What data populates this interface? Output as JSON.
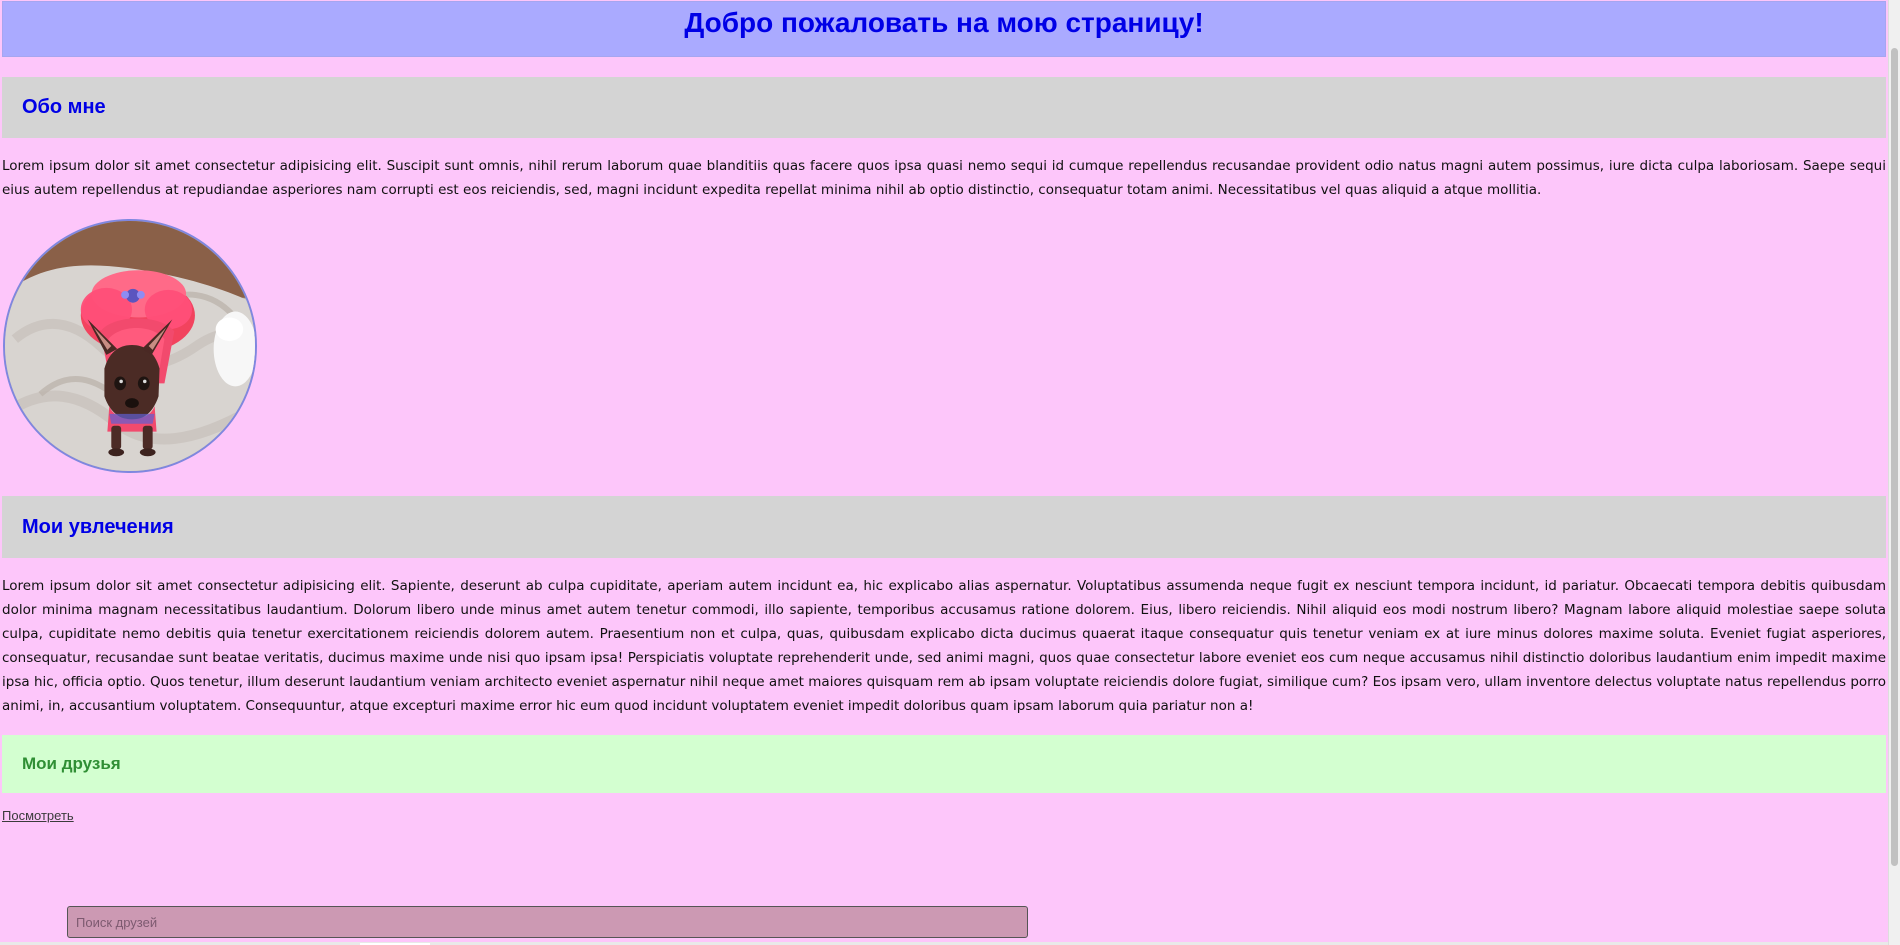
{
  "header": {
    "title": "Добро пожаловать на мою страницу!"
  },
  "about": {
    "heading": "Обо мне",
    "text": "Lorem ipsum dolor sit amet consectetur adipisicing elit. Suscipit sunt omnis, nihil rerum laborum quae blanditiis quas facere quos ipsa quasi nemo sequi id cumque repellendus recusandae provident odio natus magni autem possimus, iure dicta culpa laboriosam. Saepe sequi eius autem repellendus at repudiandae asperiores nam corrupti est eos reiciendis, sed, magni incidunt expedita repellat minima nihil ab optio distinctio, consequatur totam animi. Necessitatibus vel quas aliquid a atque mollitia."
  },
  "avatar": {
    "icon": "dog-photo-icon"
  },
  "hobbies": {
    "heading": "Мои увлечения",
    "text": "Lorem ipsum dolor sit amet consectetur adipisicing elit. Sapiente, deserunt ab culpa cupiditate, aperiam autem incidunt ea, hic explicabo alias aspernatur. Voluptatibus assumenda neque fugit ex nesciunt tempora incidunt, id pariatur. Obcaecati tempora debitis quibusdam dolor minima magnam necessitatibus laudantium. Dolorum libero unde minus amet autem tenetur commodi, illo sapiente, temporibus accusamus ratione dolorem. Eius, libero reiciendis. Nihil aliquid eos modi nostrum libero? Magnam labore aliquid molestiae saepe soluta culpa, cupiditate nemo debitis quia tenetur exercitationem reiciendis dolorem autem. Praesentium non et culpa, quas, quibusdam explicabo dicta ducimus quaerat itaque consequatur quis tenetur veniam ex at iure minus dolores maxime soluta. Eveniet fugiat asperiores, consequatur, recusandae sunt beatae veritatis, ducimus maxime unde nisi quo ipsam ipsa! Perspiciatis voluptate reprehenderit unde, sed animi magni, quos quae consectetur labore eveniet eos cum neque accusamus nihil distinctio doloribus laudantium enim impedit maxime ipsa hic, officia optio. Quos tenetur, illum deserunt laudantium veniam architecto eveniet aspernatur nihil neque amet maiores quisquam rem ab ipsam voluptate reiciendis dolore fugiat, similique cum? Eos ipsam vero, ullam inventore delectus voluptate natus repellendus porro animi, in, accusantium voluptatem. Consequuntur, atque excepturi maxime error hic eum quod incidunt voluptatem eveniet impedit doloribus quam ipsam laborum quia pariatur non a!"
  },
  "friends": {
    "heading": "Мои друзья",
    "link_label": "Посмотреть"
  },
  "search": {
    "placeholder": "Поиск друзей",
    "value": ""
  },
  "colors": {
    "page_background": "#fdc6fa",
    "header_background": "#aaaaff",
    "section_background": "#d4d4d4",
    "friends_background": "#d3ffd0",
    "heading_blue": "#0000e6",
    "heading_green": "#2f8f34",
    "search_background": "#cc99b3"
  }
}
